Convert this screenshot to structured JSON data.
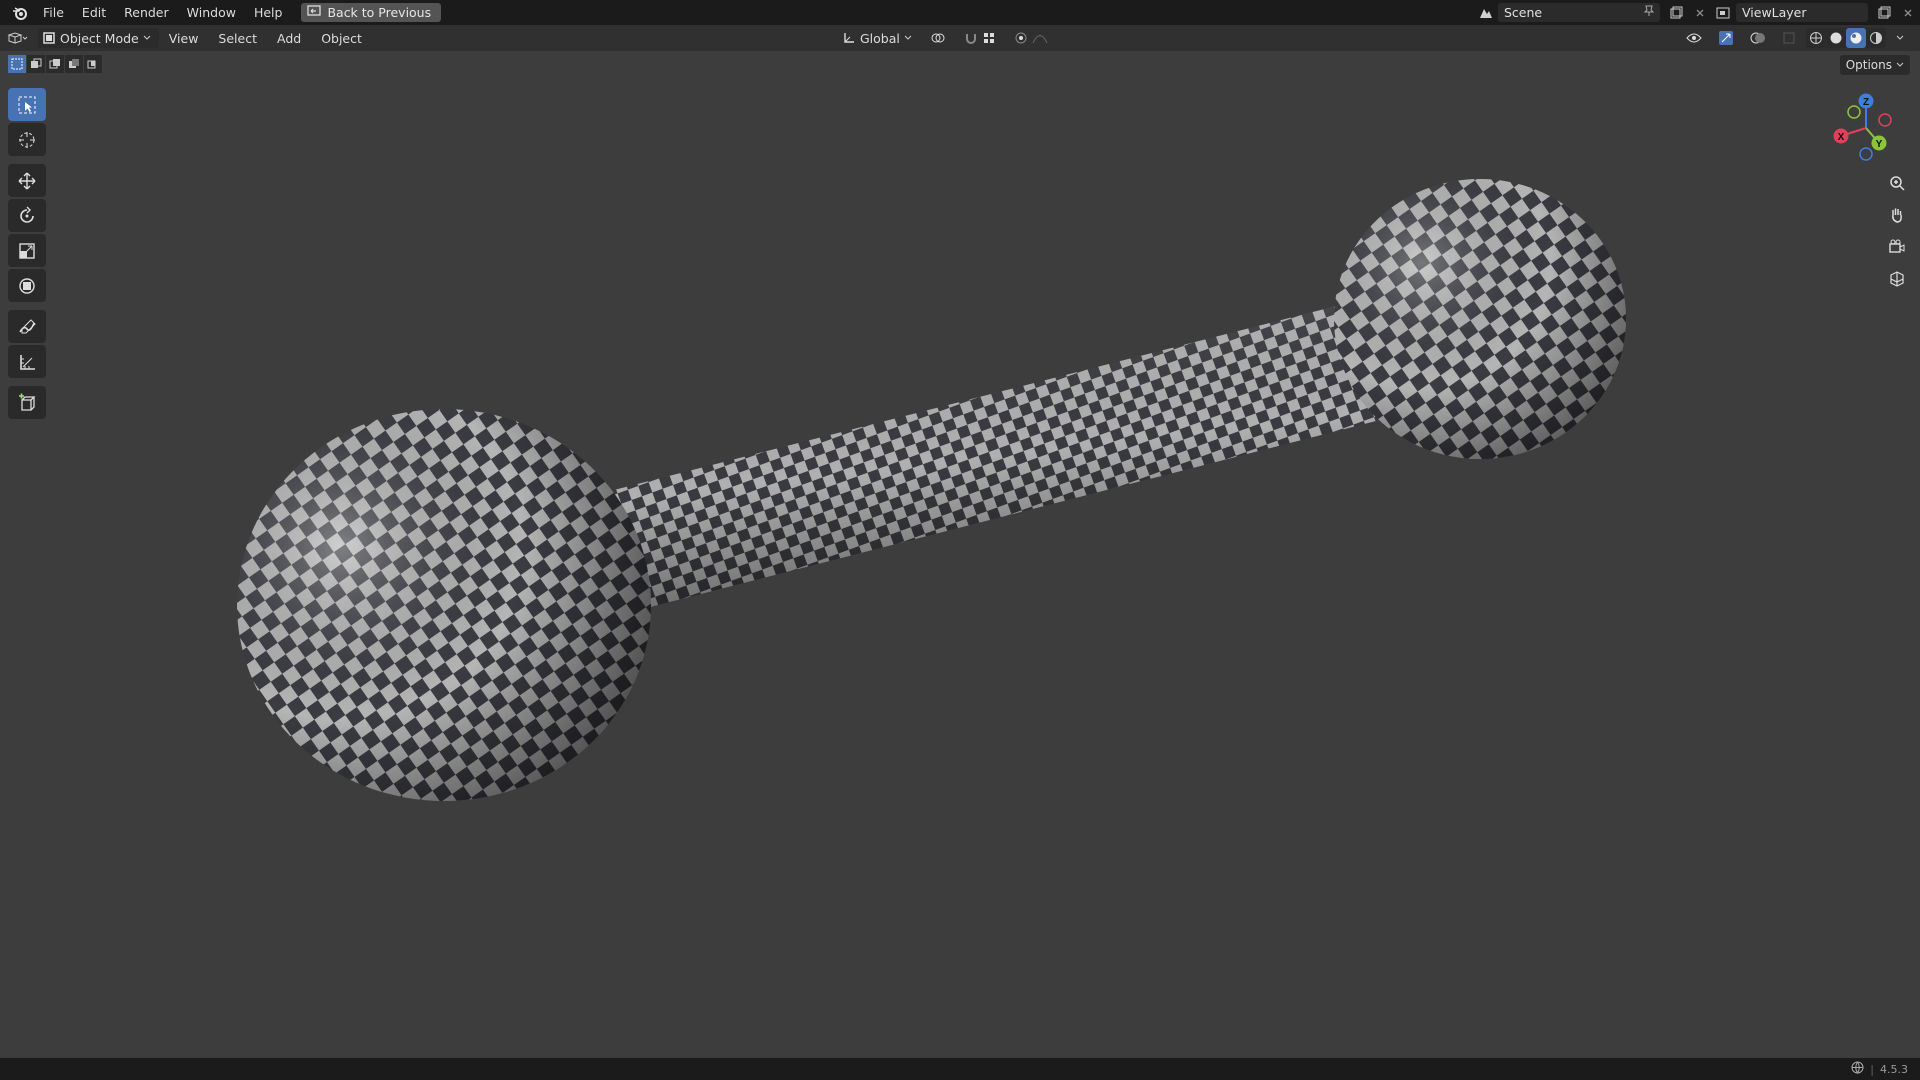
{
  "topbar": {
    "menus": [
      "File",
      "Edit",
      "Render",
      "Window",
      "Help"
    ],
    "back_label": "Back to Previous",
    "scene_label": "Scene",
    "viewlayer_label": "ViewLayer"
  },
  "header": {
    "mode_label": "Object Mode",
    "menus": [
      "View",
      "Select",
      "Add",
      "Object"
    ],
    "orientation_label": "Global",
    "options_label": "Options"
  },
  "gizmo": {
    "x_label": "X",
    "y_label": "Y",
    "z_label": "Z",
    "colors": {
      "x": "#e0405a",
      "y": "#8bc53d",
      "z": "#3d7ee0"
    }
  },
  "statusbar": {
    "version": "4.5.3"
  },
  "colors": {
    "accent": "#4772b3",
    "viewport_bg": "#3d3d3d",
    "checker_light": "#b3b3b3",
    "checker_dark": "#3a3a3a"
  }
}
